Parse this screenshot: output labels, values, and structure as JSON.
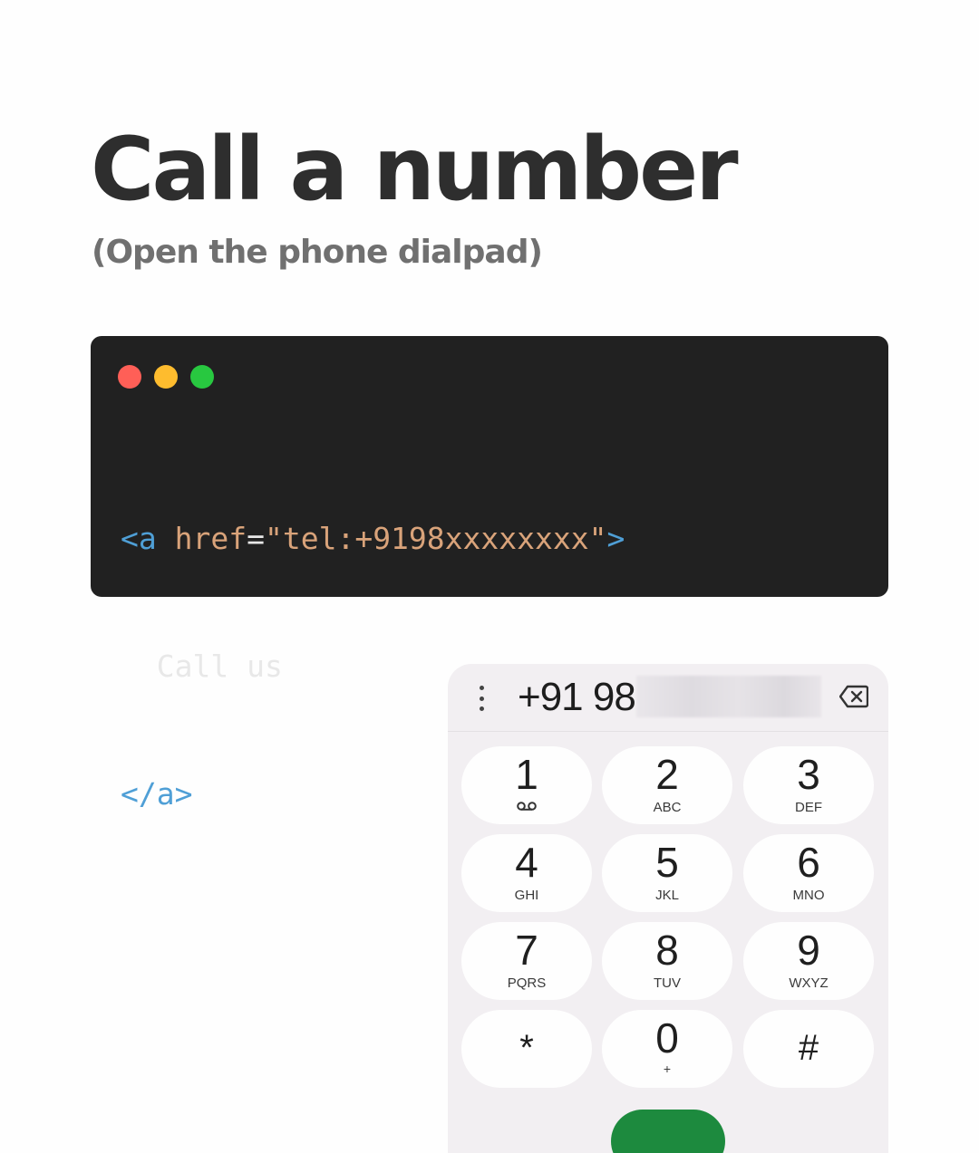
{
  "header": {
    "title": "Call a number",
    "subtitle": "(Open the phone dialpad)"
  },
  "code_window": {
    "traffic_lights": [
      "#ff5f57",
      "#febc2e",
      "#28c840"
    ],
    "line1": {
      "open_tag": "<a",
      "attr": "href",
      "eq": "=",
      "value": "\"tel:+9198xxxxxxxx\"",
      "close": ">"
    },
    "line2": "Call us",
    "line3": "</a>"
  },
  "dialer": {
    "menu_icon": "more-vert-icon",
    "dialed_visible": "+91 98",
    "backspace_icon": "backspace-icon",
    "keys": [
      {
        "digit": "1",
        "letters": "",
        "icon": "voicemail-icon"
      },
      {
        "digit": "2",
        "letters": "ABC"
      },
      {
        "digit": "3",
        "letters": "DEF"
      },
      {
        "digit": "4",
        "letters": "GHI"
      },
      {
        "digit": "5",
        "letters": "JKL"
      },
      {
        "digit": "6",
        "letters": "MNO"
      },
      {
        "digit": "7",
        "letters": "PQRS"
      },
      {
        "digit": "8",
        "letters": "TUV"
      },
      {
        "digit": "9",
        "letters": "WXYZ"
      },
      {
        "digit": "*",
        "letters": ""
      },
      {
        "digit": "0",
        "letters": "+"
      },
      {
        "digit": "#",
        "letters": ""
      }
    ],
    "call_button_color": "#1d8a3e"
  }
}
